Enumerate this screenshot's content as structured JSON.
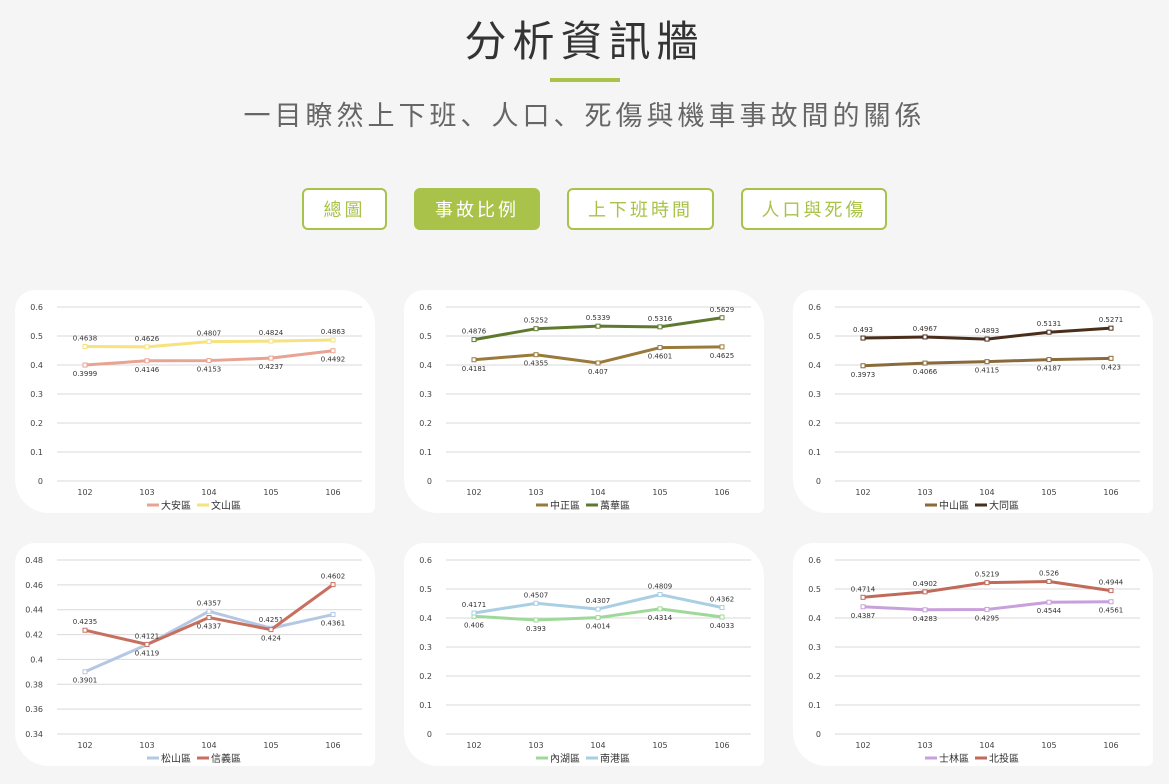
{
  "header": {
    "title": "分析資訊牆",
    "subtitle": "一目瞭然上下班、人口、死傷與機車事故間的關係"
  },
  "tabs": [
    {
      "label": "總圖",
      "active": false
    },
    {
      "label": "事故比例",
      "active": true
    },
    {
      "label": "上下班時間",
      "active": false
    },
    {
      "label": "人口與死傷",
      "active": false
    }
  ],
  "colors": {
    "accent": "#a8c24a",
    "background": "#f5f5f5"
  },
  "chart_data": [
    {
      "type": "line",
      "x": [
        "102",
        "103",
        "104",
        "105",
        "106"
      ],
      "ylim": [
        0,
        0.6
      ],
      "yticks": [
        "0",
        "0.1",
        "0.2",
        "0.3",
        "0.4",
        "0.5",
        "0.6"
      ],
      "series": [
        {
          "name": "大安區",
          "color": "#e8a393",
          "values": [
            0.3999,
            0.4146,
            0.4153,
            0.4237,
            0.4492
          ],
          "labels": [
            "0.3999",
            "0.4146",
            "0.4153",
            "0.4237",
            "0.4492"
          ]
        },
        {
          "name": "文山區",
          "color": "#f6e27f",
          "values": [
            0.4638,
            0.4626,
            0.4807,
            0.4824,
            0.4863
          ],
          "labels": [
            "0.4638",
            "0.4626",
            "0.4807",
            "0.4824",
            "0.4863"
          ]
        }
      ]
    },
    {
      "type": "line",
      "x": [
        "102",
        "103",
        "104",
        "105",
        "106"
      ],
      "ylim": [
        0,
        0.6
      ],
      "yticks": [
        "0",
        "0.1",
        "0.2",
        "0.3",
        "0.4",
        "0.5",
        "0.6"
      ],
      "series": [
        {
          "name": "中正區",
          "color": "#9a7a3c",
          "values": [
            0.4181,
            0.4355,
            0.407,
            0.4601,
            0.4625
          ],
          "labels": [
            "0.4181",
            "0.4355",
            "0.407",
            "0.4601",
            "0.4625"
          ]
        },
        {
          "name": "萬華區",
          "color": "#5f7a2f",
          "values": [
            0.4876,
            0.5252,
            0.5339,
            0.5316,
            0.5629
          ],
          "labels": [
            "0.4876",
            "0.5252",
            "0.5339",
            "0.5316",
            "0.5629"
          ]
        }
      ]
    },
    {
      "type": "line",
      "x": [
        "102",
        "103",
        "104",
        "105",
        "106"
      ],
      "ylim": [
        0,
        0.6
      ],
      "yticks": [
        "0",
        "0.1",
        "0.2",
        "0.3",
        "0.4",
        "0.5",
        "0.6"
      ],
      "series": [
        {
          "name": "中山區",
          "color": "#8a6a3a",
          "values": [
            0.3973,
            0.4066,
            0.4115,
            0.4187,
            0.423
          ],
          "labels": [
            "0.3973",
            "0.4066",
            "0.4115",
            "0.4187",
            "0.423"
          ]
        },
        {
          "name": "大同區",
          "color": "#4a2e1c",
          "values": [
            0.493,
            0.4967,
            0.4893,
            0.5131,
            0.5271
          ],
          "labels": [
            "0.493",
            "0.4967",
            "0.4893",
            "0.5131",
            "0.5271"
          ]
        }
      ]
    },
    {
      "type": "line",
      "x": [
        "102",
        "103",
        "104",
        "105",
        "106"
      ],
      "ylim": [
        0.34,
        0.48
      ],
      "yticks": [
        "0.34",
        "0.36",
        "0.38",
        "0.4",
        "0.42",
        "0.44",
        "0.46",
        "0.48"
      ],
      "series": [
        {
          "name": "松山區",
          "color": "#b5c8e3",
          "values": [
            0.3901,
            0.4119,
            0.4387,
            0.4251,
            0.4361
          ],
          "labels": [
            "0.3901",
            "0.4119",
            "0.4357",
            "0.4251",
            "0.4361"
          ]
        },
        {
          "name": "信義區",
          "color": "#c87060",
          "values": [
            0.4235,
            0.4121,
            0.4337,
            0.424,
            0.4602
          ],
          "labels": [
            "0.4235",
            "0.4121",
            "0.4337",
            "0.424",
            "0.4602"
          ]
        }
      ]
    },
    {
      "type": "line",
      "x": [
        "102",
        "103",
        "104",
        "105",
        "106"
      ],
      "ylim": [
        0,
        0.6
      ],
      "yticks": [
        "0",
        "0.1",
        "0.2",
        "0.3",
        "0.4",
        "0.5",
        "0.6"
      ],
      "series": [
        {
          "name": "內湖區",
          "color": "#9fd99a",
          "values": [
            0.406,
            0.393,
            0.4014,
            0.4314,
            0.4033
          ],
          "labels": [
            "0.406",
            "0.393",
            "0.4014",
            "0.4314",
            "0.4033"
          ]
        },
        {
          "name": "南港區",
          "color": "#a9cfe3",
          "values": [
            0.4171,
            0.4507,
            0.4307,
            0.4809,
            0.4362
          ],
          "labels": [
            "0.4171",
            "0.4507",
            "0.4307",
            "0.4809",
            "0.4362"
          ]
        }
      ]
    },
    {
      "type": "line",
      "x": [
        "102",
        "103",
        "104",
        "105",
        "106"
      ],
      "ylim": [
        0,
        0.6
      ],
      "yticks": [
        "0",
        "0.1",
        "0.2",
        "0.3",
        "0.4",
        "0.5",
        "0.6"
      ],
      "series": [
        {
          "name": "士林區",
          "color": "#c8a0db",
          "values": [
            0.4387,
            0.4283,
            0.4295,
            0.4544,
            0.4561
          ],
          "labels": [
            "0.4387",
            "0.4283",
            "0.4295",
            "0.4544",
            "0.4561"
          ]
        },
        {
          "name": "北投區",
          "color": "#c06a5a",
          "values": [
            0.4714,
            0.4902,
            0.5219,
            0.526,
            0.4944
          ],
          "labels": [
            "0.4714",
            "0.4902",
            "0.5219",
            "0.526",
            "0.4944"
          ]
        }
      ]
    }
  ]
}
